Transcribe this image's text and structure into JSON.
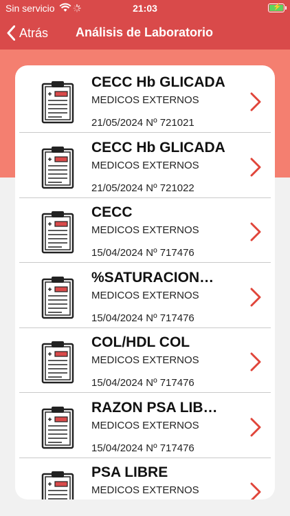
{
  "status": {
    "carrier": "Sin servicio",
    "time": "21:03"
  },
  "nav": {
    "back_label": "Atrás",
    "title": "Análisis de Laboratorio"
  },
  "colors": {
    "accent": "#d94a4a",
    "band": "#f47f70",
    "chevron": "#e0453a"
  },
  "results": [
    {
      "title": "CECC Hb GLICADA",
      "source": "MEDICOS EXTERNOS",
      "date_line": "21/05/2024 Nº 721021"
    },
    {
      "title": "CECC Hb GLICADA",
      "source": "MEDICOS EXTERNOS",
      "date_line": "21/05/2024 Nº 721022"
    },
    {
      "title": "CECC",
      "source": "MEDICOS EXTERNOS",
      "date_line": "15/04/2024 Nº 717476"
    },
    {
      "title": "%SATURACION…",
      "source": "MEDICOS EXTERNOS",
      "date_line": "15/04/2024 Nº 717476"
    },
    {
      "title": "COL/HDL COL",
      "source": "MEDICOS EXTERNOS",
      "date_line": "15/04/2024 Nº 717476"
    },
    {
      "title": "RAZON PSA LIB…",
      "source": "MEDICOS EXTERNOS",
      "date_line": "15/04/2024 Nº 717476"
    },
    {
      "title": "PSA LIBRE",
      "source": "MEDICOS EXTERNOS",
      "date_line": ""
    }
  ]
}
